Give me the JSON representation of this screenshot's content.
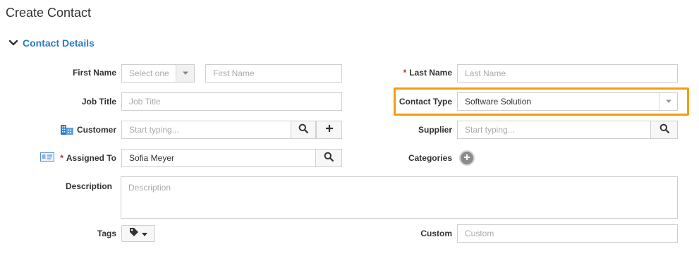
{
  "page": {
    "title": "Create Contact"
  },
  "section": {
    "title": "Contact Details"
  },
  "form": {
    "first_name_label": "First Name",
    "salutation_value": "Select one",
    "first_name_placeholder": "First Name",
    "last_name_label": "Last Name",
    "last_name_placeholder": "Last Name",
    "job_title_label": "Job Title",
    "job_title_placeholder": "Job Title",
    "contact_type_label": "Contact Type",
    "contact_type_value": "Software Solution",
    "customer_label": "Customer",
    "customer_placeholder": "Start typing...",
    "supplier_label": "Supplier",
    "supplier_placeholder": "Start typing...",
    "assigned_to_label": "Assigned To",
    "assigned_to_value": "Sofia Meyer",
    "categories_label": "Categories",
    "description_label": "Description",
    "description_placeholder": "Description",
    "tags_label": "Tags",
    "custom_label": "Custom",
    "custom_placeholder": "Custom",
    "required_mark": "*"
  },
  "colors": {
    "accent": "#2b7bc9",
    "highlight": "#f39c12",
    "required": "#c62828"
  },
  "icons": {
    "section_toggle": "chevron-down-icon",
    "customer": "building-icon",
    "assigned_to": "id-card-icon",
    "search": "search-icon",
    "add": "plus-icon",
    "tags": "tag-icon",
    "dropdown": "caret-down-icon"
  }
}
